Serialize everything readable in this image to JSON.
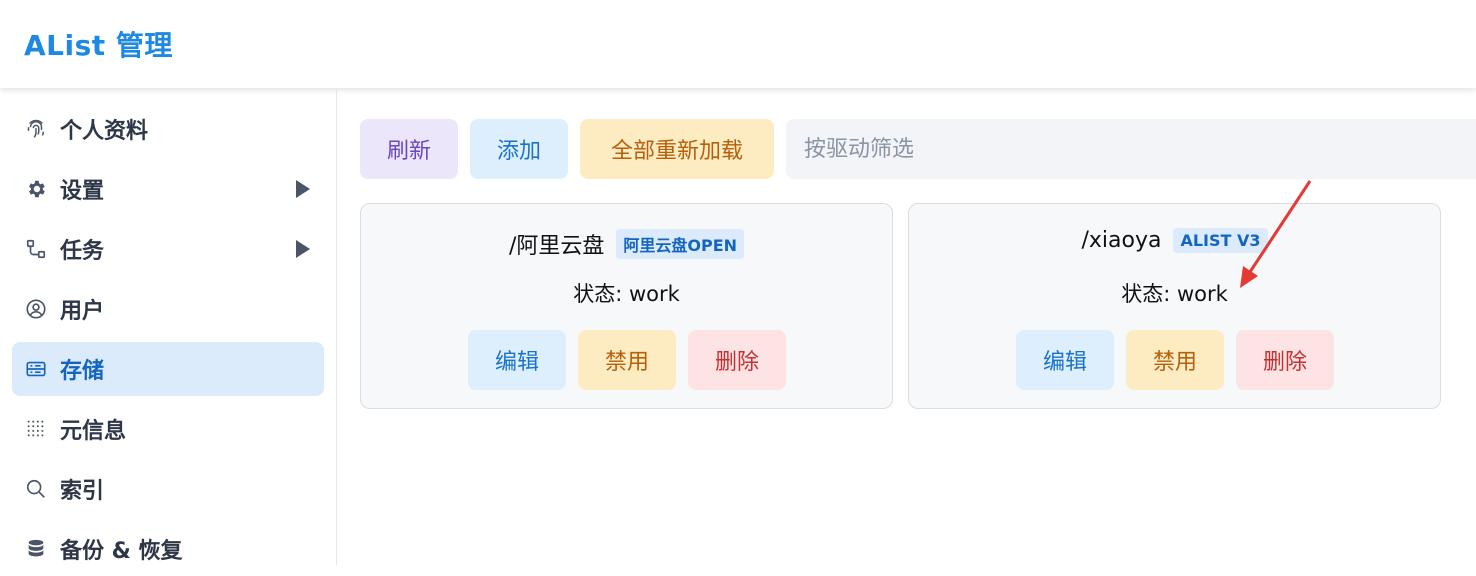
{
  "header": {
    "title": "AList 管理"
  },
  "sidebar": {
    "items": [
      {
        "label": "个人资料",
        "icon": "fingerprint-icon"
      },
      {
        "label": "设置",
        "icon": "gear-icon",
        "expandable": true
      },
      {
        "label": "任务",
        "icon": "task-flow-icon",
        "expandable": true
      },
      {
        "label": "用户",
        "icon": "user-circle-icon"
      },
      {
        "label": "存储",
        "icon": "storage-icon",
        "active": true
      },
      {
        "label": "元信息",
        "icon": "dots-grid-icon"
      },
      {
        "label": "索引",
        "icon": "search-icon"
      },
      {
        "label": "备份 & 恢复",
        "icon": "database-icon"
      }
    ]
  },
  "toolbar": {
    "refresh_label": "刷新",
    "add_label": "添加",
    "reload_all_label": "全部重新加载",
    "filter_placeholder": "按驱动筛选"
  },
  "storages": [
    {
      "mount_path": "/阿里云盘",
      "driver": "阿里云盘OPEN",
      "status": "状态: work",
      "edit_label": "编辑",
      "disable_label": "禁用",
      "delete_label": "删除"
    },
    {
      "mount_path": "/xiaoya",
      "driver": "ALIST V3",
      "status": "状态: work",
      "edit_label": "编辑",
      "disable_label": "禁用",
      "delete_label": "删除"
    }
  ],
  "colors": {
    "accent": "#1e88e5",
    "active_bg": "#dcebfb",
    "annotation_arrow": "#e53935"
  }
}
